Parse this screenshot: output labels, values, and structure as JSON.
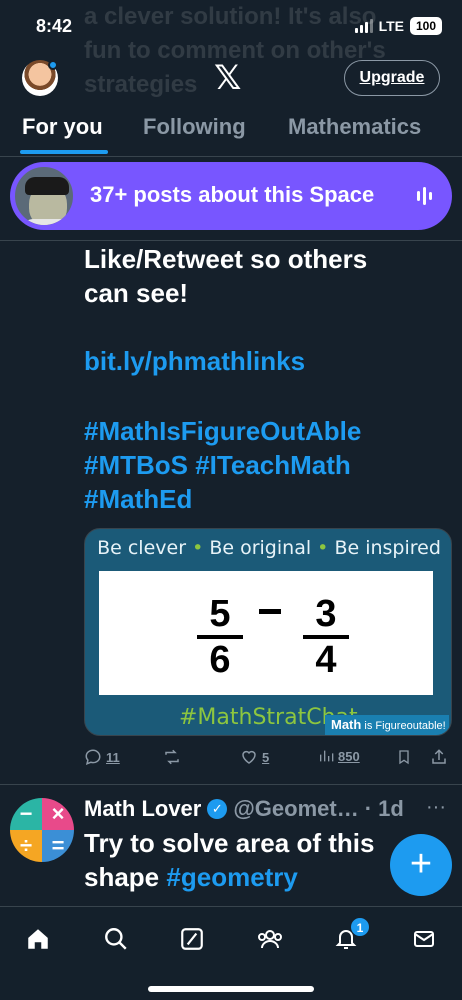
{
  "status": {
    "time": "8:42",
    "network": "LTE",
    "battery": "100"
  },
  "background_ghost_text": "a clever solution! It's also fun to comment on other's strategies",
  "header": {
    "logo": "𝕏",
    "upgrade_label": "Upgrade"
  },
  "tabs": [
    {
      "label": "For you",
      "active": true
    },
    {
      "label": "Following",
      "active": false
    },
    {
      "label": "Mathematics",
      "active": false
    }
  ],
  "space_banner": {
    "label": "37+ posts about this Space",
    "color": "#7856ff"
  },
  "tweet1": {
    "line1": "Like/Retweet so others",
    "line2": "can see!",
    "link": "bit.ly/phmathlinks",
    "hashtags_line1": "#MathIsFigureOutAble",
    "hashtags_line2": "#MTBoS #ITeachMath",
    "hashtags_line3": "#MathEd",
    "media": {
      "tagline_1": "Be clever",
      "tagline_sep": "•",
      "tagline_2": "Be original",
      "tagline_3": "Be inspired",
      "fraction_a_num": "5",
      "fraction_a_den": "6",
      "operator": "–",
      "fraction_b_num": "3",
      "fraction_b_den": "4",
      "hashtag": "#MathStratChat",
      "brand_bold": "Math",
      "brand_rest": "is Figureoutable!™"
    },
    "actions": {
      "replies": "11",
      "likes": "5",
      "views": "850"
    }
  },
  "tweet2": {
    "name": "Math Lover",
    "handle": "@Geomet…",
    "time": "· 1d",
    "text_line1": "Try to solve area of this",
    "text_line2_plain": "shape",
    "text_line2_tag": "#geometry"
  },
  "nav": {
    "items": [
      "home-icon",
      "search-icon",
      "grok-icon",
      "communities-icon",
      "notifications-icon",
      "messages-icon"
    ],
    "notification_count": "1"
  },
  "colors": {
    "accent": "#1d9bf0",
    "background": "#15202b",
    "space": "#7856ff"
  }
}
